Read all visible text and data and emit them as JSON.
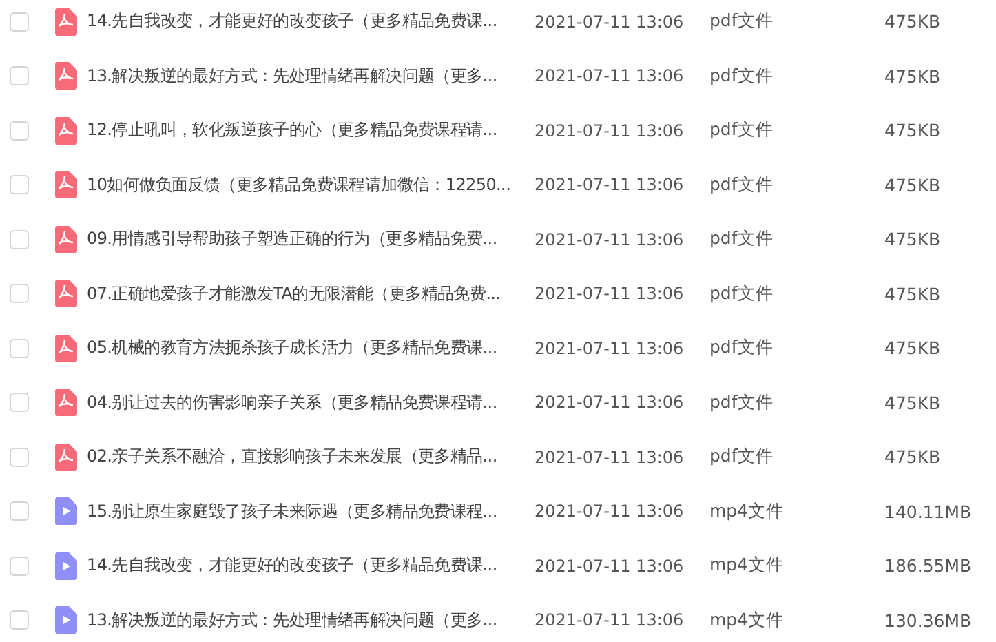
{
  "files": [
    {
      "kind": "pdf",
      "checked": false,
      "name": "14.先自我改变，才能更好的改变孩子（更多精品免费课...",
      "date": "2021-07-11 13:06",
      "type": "pdf文件",
      "size": "475KB"
    },
    {
      "kind": "pdf",
      "checked": false,
      "name": "13.解决叛逆的最好方式：先处理情绪再解决问题（更多...",
      "date": "2021-07-11 13:06",
      "type": "pdf文件",
      "size": "475KB"
    },
    {
      "kind": "pdf",
      "checked": false,
      "name": "12.停止吼叫，软化叛逆孩子的心（更多精品免费课程请...",
      "date": "2021-07-11 13:06",
      "type": "pdf文件",
      "size": "475KB"
    },
    {
      "kind": "pdf",
      "checked": false,
      "name": "10如何做负面反馈（更多精品免费课程请加微信：12250...",
      "date": "2021-07-11 13:06",
      "type": "pdf文件",
      "size": "475KB"
    },
    {
      "kind": "pdf",
      "checked": false,
      "name": "09.用情感引导帮助孩子塑造正确的行为（更多精品免费...",
      "date": "2021-07-11 13:06",
      "type": "pdf文件",
      "size": "475KB"
    },
    {
      "kind": "pdf",
      "checked": false,
      "name": "07.正确地爱孩子才能激发TA的无限潜能（更多精品免费...",
      "date": "2021-07-11 13:06",
      "type": "pdf文件",
      "size": "475KB"
    },
    {
      "kind": "pdf",
      "checked": false,
      "name": "05.机械的教育方法扼杀孩子成长活力（更多精品免费课...",
      "date": "2021-07-11 13:06",
      "type": "pdf文件",
      "size": "475KB"
    },
    {
      "kind": "pdf",
      "checked": false,
      "name": "04.别让过去的伤害影响亲子关系（更多精品免费课程请...",
      "date": "2021-07-11 13:06",
      "type": "pdf文件",
      "size": "475KB"
    },
    {
      "kind": "pdf",
      "checked": false,
      "name": "02.亲子关系不融洽，直接影响孩子未来发展（更多精品...",
      "date": "2021-07-11 13:06",
      "type": "pdf文件",
      "size": "475KB"
    },
    {
      "kind": "video",
      "checked": false,
      "name": "15.别让原生家庭毁了孩子未来际遇（更多精品免费课程...",
      "date": "2021-07-11 13:06",
      "type": "mp4文件",
      "size": "140.11MB"
    },
    {
      "kind": "video",
      "checked": false,
      "name": "14.先自我改变，才能更好的改变孩子（更多精品免费课...",
      "date": "2021-07-11 13:06",
      "type": "mp4文件",
      "size": "186.55MB"
    },
    {
      "kind": "video",
      "checked": false,
      "name": "13.解决叛逆的最好方式：先处理情绪再解决问题（更多...",
      "date": "2021-07-11 13:06",
      "type": "mp4文件",
      "size": "130.36MB"
    }
  ]
}
